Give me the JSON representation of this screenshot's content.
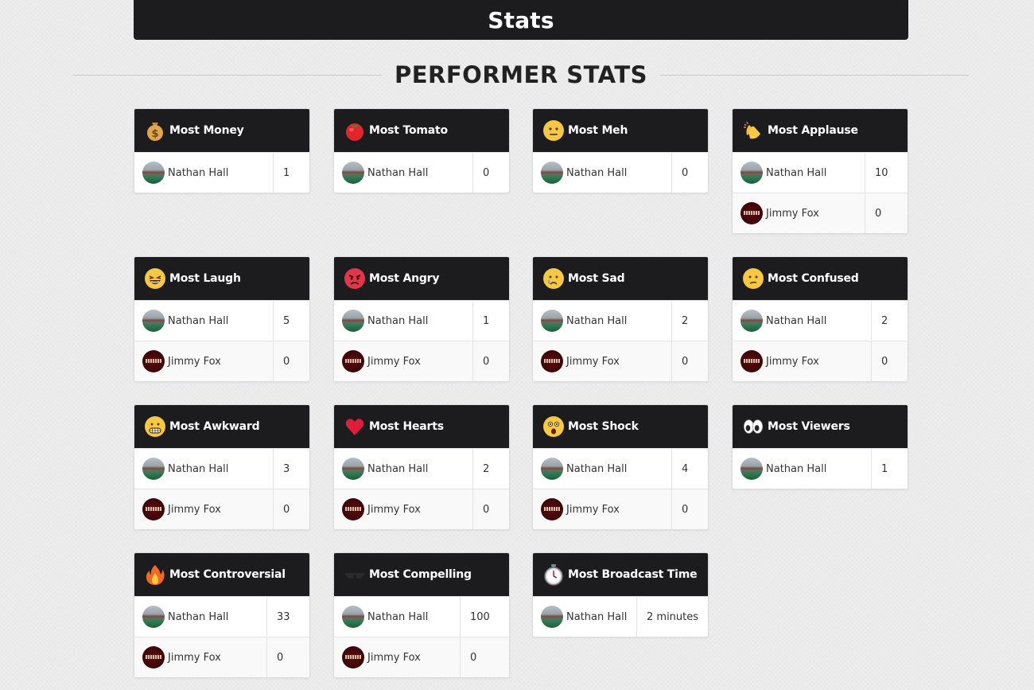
{
  "header": {
    "title": "Stats"
  },
  "section": {
    "title": "PERFORMER STATS"
  },
  "cards": [
    {
      "title": "Most Money",
      "icon": "money-bag-icon",
      "rows": [
        {
          "name": "Nathan Hall",
          "value": "1",
          "avatar": "nathan"
        }
      ]
    },
    {
      "title": "Most Tomato",
      "icon": "tomato-icon",
      "rows": [
        {
          "name": "Nathan Hall",
          "value": "0",
          "avatar": "nathan"
        }
      ]
    },
    {
      "title": "Most Meh",
      "icon": "neutral-face-icon",
      "rows": [
        {
          "name": "Nathan Hall",
          "value": "0",
          "avatar": "nathan"
        }
      ]
    },
    {
      "title": "Most Applause",
      "icon": "clapping-hands-icon",
      "rows": [
        {
          "name": "Nathan Hall",
          "value": "10",
          "avatar": "nathan"
        },
        {
          "name": "Jimmy Fox",
          "value": "0",
          "avatar": "jimmy"
        }
      ]
    },
    {
      "title": "Most Laugh",
      "icon": "laughing-face-icon",
      "rows": [
        {
          "name": "Nathan Hall",
          "value": "5",
          "avatar": "nathan"
        },
        {
          "name": "Jimmy Fox",
          "value": "0",
          "avatar": "jimmy"
        }
      ]
    },
    {
      "title": "Most Angry",
      "icon": "angry-face-icon",
      "rows": [
        {
          "name": "Nathan Hall",
          "value": "1",
          "avatar": "nathan"
        },
        {
          "name": "Jimmy Fox",
          "value": "0",
          "avatar": "jimmy"
        }
      ]
    },
    {
      "title": "Most Sad",
      "icon": "crying-face-icon",
      "rows": [
        {
          "name": "Nathan Hall",
          "value": "2",
          "avatar": "nathan"
        },
        {
          "name": "Jimmy Fox",
          "value": "0",
          "avatar": "jimmy"
        }
      ]
    },
    {
      "title": "Most Confused",
      "icon": "confused-face-icon",
      "rows": [
        {
          "name": "Nathan Hall",
          "value": "2",
          "avatar": "nathan"
        },
        {
          "name": "Jimmy Fox",
          "value": "0",
          "avatar": "jimmy"
        }
      ]
    },
    {
      "title": "Most Awkward",
      "icon": "grimacing-face-icon",
      "rows": [
        {
          "name": "Nathan Hall",
          "value": "3",
          "avatar": "nathan"
        },
        {
          "name": "Jimmy Fox",
          "value": "0",
          "avatar": "jimmy"
        }
      ]
    },
    {
      "title": "Most Hearts",
      "icon": "heart-icon",
      "rows": [
        {
          "name": "Nathan Hall",
          "value": "2",
          "avatar": "nathan"
        },
        {
          "name": "Jimmy Fox",
          "value": "0",
          "avatar": "jimmy"
        }
      ]
    },
    {
      "title": "Most Shock",
      "icon": "shocked-face-icon",
      "rows": [
        {
          "name": "Nathan Hall",
          "value": "4",
          "avatar": "nathan"
        },
        {
          "name": "Jimmy Fox",
          "value": "0",
          "avatar": "jimmy"
        }
      ]
    },
    {
      "title": "Most Viewers",
      "icon": "eyes-icon",
      "rows": [
        {
          "name": "Nathan Hall",
          "value": "1",
          "avatar": "nathan"
        }
      ]
    },
    {
      "title": "Most Controversial",
      "icon": "fire-icon",
      "rows": [
        {
          "name": "Nathan Hall",
          "value": "33",
          "avatar": "nathan"
        },
        {
          "name": "Jimmy Fox",
          "value": "0",
          "avatar": "jimmy"
        }
      ]
    },
    {
      "title": "Most Compelling",
      "icon": "sunglasses-icon",
      "rows": [
        {
          "name": "Nathan Hall",
          "value": "100",
          "avatar": "nathan"
        },
        {
          "name": "Jimmy Fox",
          "value": "0",
          "avatar": "jimmy"
        }
      ]
    },
    {
      "title": "Most Broadcast Time",
      "icon": "stopwatch-icon",
      "rows": [
        {
          "name": "Nathan Hall",
          "value": "2 minutes",
          "avatar": "nathan"
        }
      ]
    }
  ]
}
